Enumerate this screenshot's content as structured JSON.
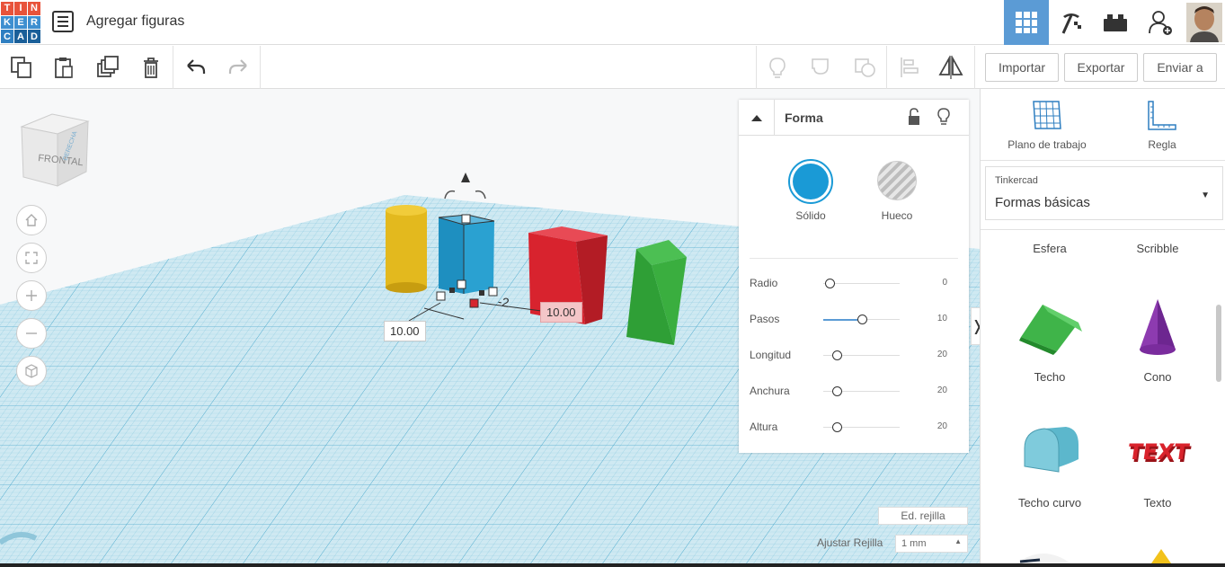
{
  "app": {
    "logo_letters": [
      "T",
      "I",
      "N",
      "K",
      "E",
      "R",
      "C",
      "A",
      "D"
    ],
    "logo_colors": [
      "#e8533a",
      "#e8533a",
      "#e8533a",
      "#3e8fd0",
      "#3e8fd0",
      "#3e8fd0",
      "#2f7fc1",
      "#1a5f99",
      "#1a5f99"
    ],
    "title": "Agregar figuras"
  },
  "toolbar": {
    "import_label": "Importar",
    "export_label": "Exportar",
    "send_label": "Enviar a"
  },
  "workplane": {
    "view_cube_front": "FRONTAL",
    "view_cube_side": "DERECHA",
    "dim_width": "10.00",
    "dim_length": "10.00",
    "dim_side": "-2",
    "edit_grid_label": "Ed. rejilla",
    "snap_grid_label": "Ajustar Rejilla",
    "snap_grid_value": "1 mm"
  },
  "inspector": {
    "title": "Forma",
    "solid_label": "Sólido",
    "hole_label": "Hueco",
    "solid_color": "#1a9ad6",
    "params": [
      {
        "label": "Radio",
        "value": "0",
        "fraction": 0.0
      },
      {
        "label": "Pasos",
        "value": "10",
        "fraction": 0.45
      },
      {
        "label": "Longitud",
        "value": "20",
        "fraction": 0.08
      },
      {
        "label": "Anchura",
        "value": "20",
        "fraction": 0.08
      },
      {
        "label": "Altura",
        "value": "20",
        "fraction": 0.08
      }
    ]
  },
  "sidebar": {
    "workplane_label": "Plano de trabajo",
    "ruler_label": "Regla",
    "library_source": "Tinkercad",
    "library_name": "Formas básicas",
    "shapes": [
      {
        "label": "Esfera"
      },
      {
        "label": "Scribble"
      },
      {
        "label": "Techo"
      },
      {
        "label": "Cono"
      },
      {
        "label": "Techo curvo"
      },
      {
        "label": "Texto"
      }
    ],
    "text_shape_word": "TEXT"
  }
}
